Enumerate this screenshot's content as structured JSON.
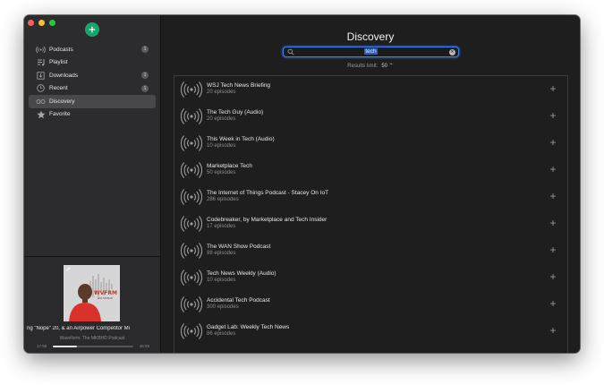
{
  "sidebar": {
    "items": [
      {
        "label": "Podcasts",
        "icon": "broadcast-icon",
        "badge": "1"
      },
      {
        "label": "Playlist",
        "icon": "playlist-icon",
        "badge": ""
      },
      {
        "label": "Downloads",
        "icon": "download-icon",
        "badge": "1"
      },
      {
        "label": "Recent",
        "icon": "clock-icon",
        "badge": "1"
      },
      {
        "label": "Discovery",
        "icon": "discovery-icon",
        "badge": "",
        "active": true
      },
      {
        "label": "Favorite",
        "icon": "star-icon",
        "badge": ""
      }
    ]
  },
  "player": {
    "artwork_label": "WVFRM",
    "artwork_sub": "with MKBHD",
    "title": "ng \"Nope\" 20, & an Airpower Competitor   Mi",
    "subtitle": "Waveform: The MKBHD Podcast",
    "elapsed": "17:58",
    "remaining": "46:59",
    "progress": 0.3
  },
  "main": {
    "title": "Discovery",
    "search_value": "tech",
    "results_limit_label": "Results limit:",
    "results_limit_value": "50 ⌃"
  },
  "results": [
    {
      "title": "WSJ Tech News Briefing",
      "episodes": "20 episodes"
    },
    {
      "title": "The Tech Guy (Audio)",
      "episodes": "20 episodes"
    },
    {
      "title": "This Week in Tech (Audio)",
      "episodes": "10 episodes"
    },
    {
      "title": "Marketplace Tech",
      "episodes": "50 episodes"
    },
    {
      "title": "The Internet of Things Podcast - Stacey On IoT",
      "episodes": "286 episodes"
    },
    {
      "title": "Codebreaker, by Marketplace and Tech Insider",
      "episodes": "17 episodes"
    },
    {
      "title": "The WAN Show Podcast",
      "episodes": "98 episodes"
    },
    {
      "title": "Tech News Weekly (Audio)",
      "episodes": "10 episodes"
    },
    {
      "title": "Accidental Tech Podcast",
      "episodes": "300 episodes"
    },
    {
      "title": "Gadget Lab: Weekly Tech News",
      "episodes": "86 episodes"
    }
  ],
  "colors": {
    "accent": "#3a82f7",
    "logo": "#1aa36b"
  }
}
